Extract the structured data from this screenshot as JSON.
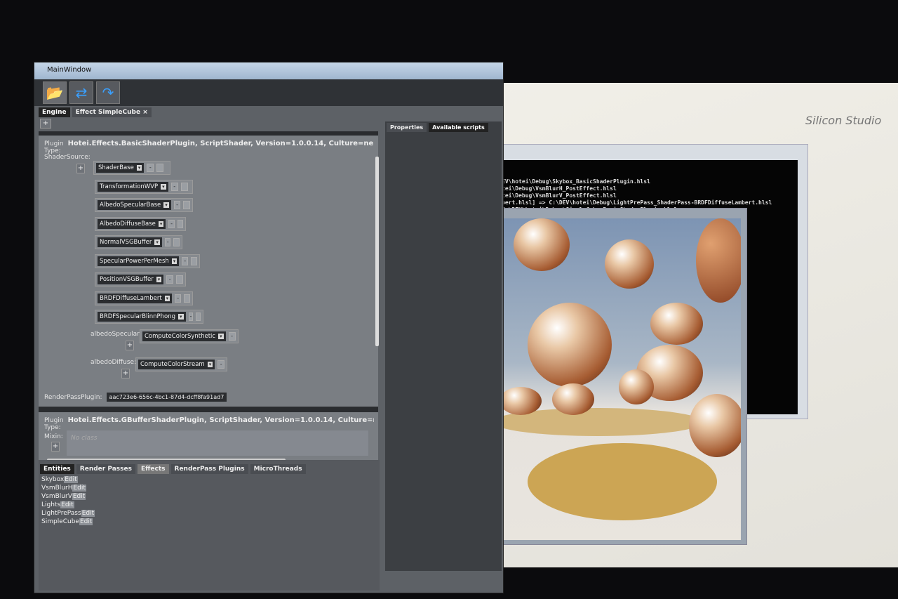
{
  "desktop": {
    "logo": "Silicon Studio"
  },
  "console": {
    "lines": [
      "EV\\hotei\\Debug\\Skybox_BasicShaderPlugin.hlsl",
      "tei\\Debug\\VsmBlurH_PostEffect.hlsl",
      "tei\\Debug\\VsmBlurV_PostEffect.hlsl",
      "bert.hlsl] => C:\\DEV\\hotei\\Debug\\LightPrePass_ShaderPass-BRDFDiffuseLambert.hlsl",
      "C:\\DEV\\hotei\\Debug\\SimpleCube_BasicShaderPlugin.hlsl"
    ]
  },
  "main": {
    "title": "MainWindow",
    "toolbar": {
      "open": "folder-open-icon",
      "refresh": "refresh-icon",
      "redo": "redo-icon"
    },
    "tabs": [
      {
        "label": "Engine"
      },
      {
        "label": "Effect SimpleCube",
        "close": "×"
      }
    ],
    "plus": "+",
    "plugin1": {
      "type_label": "Plugin Type:",
      "type_value": "Hotei.Effects.BasicShaderPlugin, ScriptShader, Version=1.0.0.14, Culture=neutral, PublicK",
      "shader_source_label": "ShaderSource:",
      "shaders": [
        "ShaderBase",
        "TransformationWVP",
        "AlbedoSpecularBase",
        "AlbedoDiffuseBase",
        "NormalVSGBuffer",
        "SpecularPowerPerMesh",
        "PositionVSGBuffer",
        "BRDFDiffuseLambert",
        "BRDFSpecularBlinnPhong"
      ],
      "albedo_specular_label": "albedoSpecular:",
      "albedo_specular_value": "ComputeColorSynthetic",
      "albedo_diffuse_label": "albedoDiffuse:",
      "albedo_diffuse_value": "ComputeColorStream",
      "renderpass_label": "RenderPassPlugin:",
      "renderpass_value": "aac723e6-656c-4bc1-87d4-dcff8fa91ad7"
    },
    "plugin2": {
      "type_label": "Plugin Type:",
      "type_value": "Hotei.Effects.GBufferShaderPlugin, ScriptShader, Version=1.0.0.14, Culture=neutral, Publi",
      "mixin_label": "Mixin:",
      "mixin_placeholder": "No class"
    },
    "right_tabs": [
      "Properties",
      "Available scripts"
    ],
    "bottom_tabs": [
      "Entities",
      "Render Passes",
      "Effects",
      "RenderPass Plugins",
      "MicroThreads"
    ],
    "effects": [
      "Skybox",
      "VsmBlurH",
      "VsmBlurV",
      "Lights",
      "LightPrePass",
      "SimpleCube"
    ],
    "edit_label": "Edit",
    "dropdown": "▾",
    "minus": "-"
  }
}
